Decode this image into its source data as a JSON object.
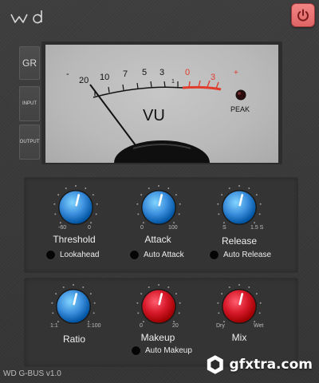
{
  "app": {
    "version": "WD G-BUS v1.0"
  },
  "header": {
    "power_state": "on"
  },
  "sidebar": {
    "gr_label": "GR",
    "input_label": "INPUT",
    "output_label": "OUTPUT",
    "selected": "GR"
  },
  "meter": {
    "scale_labels": [
      "-",
      "20",
      "10",
      "7",
      "5",
      "3",
      "1",
      "0",
      "3",
      "+"
    ],
    "unit_label": "VU",
    "peak_label": "PEAK",
    "colors": {
      "face": "#bcbcbc",
      "red_zone": "#e03c2c",
      "ink": "#111111"
    }
  },
  "controls": {
    "threshold": {
      "label": "Threshold",
      "min_label": "-60",
      "max_label": "0",
      "color": "#3c8fdc",
      "value_fraction": 0.55
    },
    "attack": {
      "label": "Attack",
      "min_label": "0",
      "max_label": "100",
      "color": "#3c8fdc",
      "value_fraction": 0.55
    },
    "release": {
      "label": "Release",
      "min_label": "S",
      "max_label": "1.5 S",
      "color": "#3c8fdc",
      "value_fraction": 0.55
    },
    "ratio": {
      "label": "Ratio",
      "min_label": "1:1",
      "max_label": "1:100",
      "color": "#3c8fdc",
      "value_fraction": 0.55
    },
    "makeup": {
      "label": "Makeup",
      "min_label": "0",
      "max_label": "20",
      "color": "#d7192a",
      "value_fraction": 0.55
    },
    "mix": {
      "label": "Mix",
      "min_label": "Dry",
      "max_label": "Wet",
      "color": "#d7192a",
      "value_fraction": 0.55
    }
  },
  "toggles": {
    "lookahead": "Lookahead",
    "auto_attack": "Auto Attack",
    "auto_release": "Auto Release",
    "auto_makeup": "Auto Makeup"
  },
  "watermark": {
    "text": "gfxtra.com"
  }
}
